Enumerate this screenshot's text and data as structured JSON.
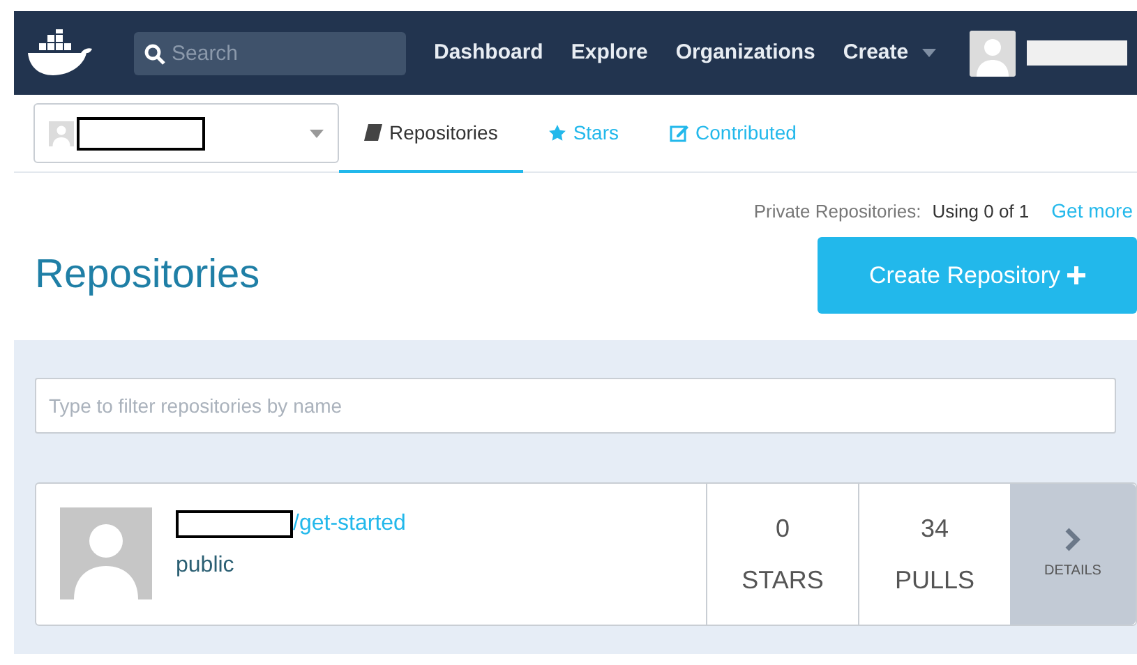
{
  "navbar": {
    "search": {
      "placeholder": "Search"
    },
    "links": [
      "Dashboard",
      "Explore",
      "Organizations",
      "Create"
    ]
  },
  "tabs": [
    {
      "label": "Repositories",
      "selected": true
    },
    {
      "label": "Stars",
      "selected": false
    },
    {
      "label": "Contributed",
      "selected": false
    }
  ],
  "quota": {
    "label": "Private Repositories:",
    "usage": "Using 0 of 1",
    "link": "Get more"
  },
  "heading": "Repositories",
  "create_button": "Create Repository",
  "filter": {
    "placeholder": "Type to filter repositories by name"
  },
  "repositories": [
    {
      "name": "/get-started",
      "visibility": "public",
      "stars": "0",
      "stars_label": "STARS",
      "pulls": "34",
      "pulls_label": "PULLS",
      "details": "DETAILS"
    }
  ]
}
